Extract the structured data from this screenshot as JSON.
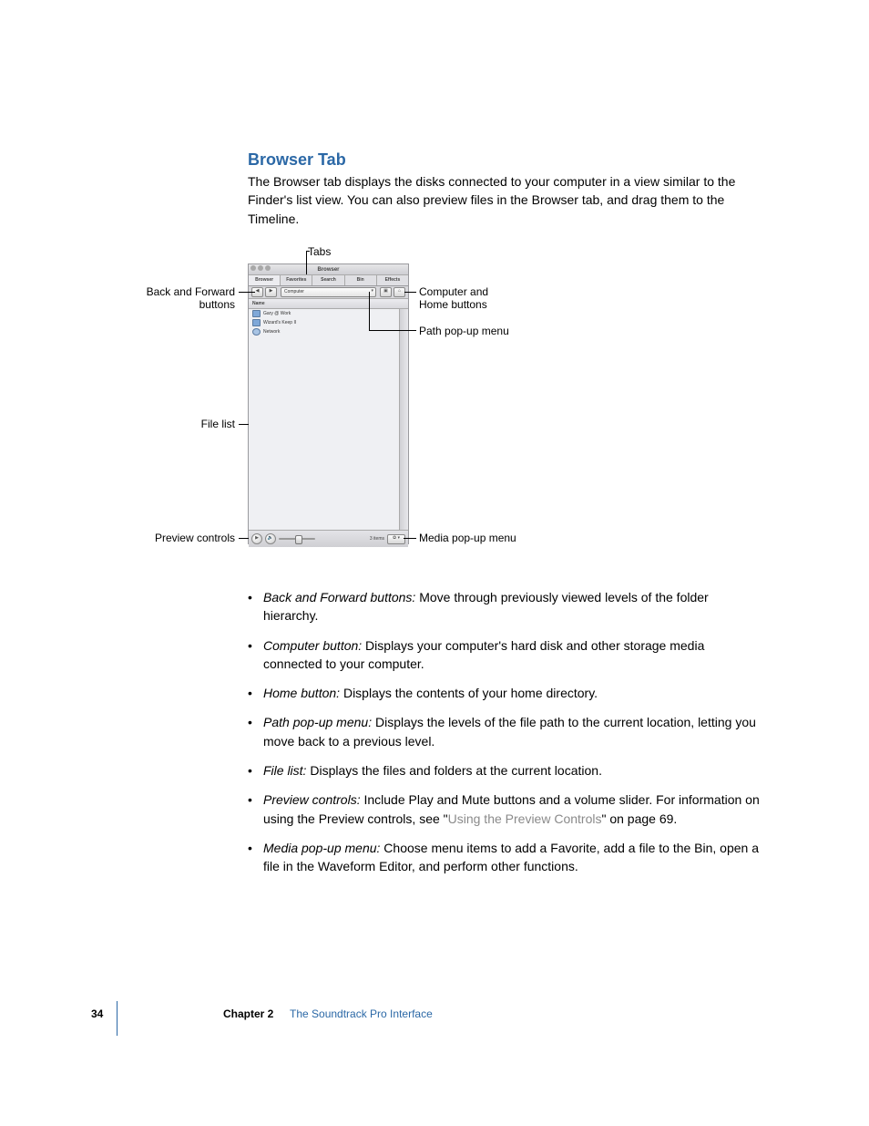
{
  "section": {
    "title": "Browser Tab",
    "intro": "The Browser tab displays the disks connected to your computer in a view similar to the Finder's list view. You can also preview files in the Browser tab, and drag them to the Timeline."
  },
  "callouts": {
    "tabs": "Tabs",
    "back_forward_l1": "Back and Forward",
    "back_forward_l2": "buttons",
    "computer_home_l1": "Computer and",
    "computer_home_l2": "Home buttons",
    "path_popup": "Path pop-up menu",
    "file_list": "File list",
    "preview_controls": "Preview controls",
    "media_popup": "Media pop-up menu"
  },
  "figure": {
    "window_title": "Browser",
    "tabs": [
      "Browser",
      "Favorites",
      "Search",
      "Bin",
      "Effects"
    ],
    "path_label": "Computer",
    "column_header": "Name",
    "files": [
      {
        "name": "Gary @ Work",
        "kind": "disk"
      },
      {
        "name": "Wizard's Keep II",
        "kind": "disk"
      },
      {
        "name": "Network",
        "kind": "net"
      }
    ],
    "items_count": "3 items",
    "media_btn": "✿ ▾"
  },
  "bullets": [
    {
      "term": "Back and Forward buttons:",
      "desc": "  Move through previously viewed levels of the folder hierarchy."
    },
    {
      "term": "Computer button:",
      "desc": "  Displays your computer's hard disk and other storage media connected to your computer."
    },
    {
      "term": "Home button:",
      "desc": "  Displays the contents of your home directory."
    },
    {
      "term": "Path pop-up menu:",
      "desc": "  Displays the levels of the file path to the current location, letting you move back to a previous level."
    },
    {
      "term": "File list:",
      "desc": "  Displays the files and folders at the current location."
    },
    {
      "term": "Preview controls:",
      "desc": "  Include Play and Mute buttons and a volume slider. For information on using the Preview controls, see \"",
      "link": "Using the Preview Controls",
      "desc2": "\" on page 69."
    },
    {
      "term": "Media pop-up menu:",
      "desc": "  Choose menu items to add a Favorite, add a file to the Bin, open a file in the Waveform Editor, and perform other functions."
    }
  ],
  "footer": {
    "page_number": "34",
    "chapter_label": "Chapter 2",
    "chapter_title": "The Soundtrack Pro Interface"
  }
}
